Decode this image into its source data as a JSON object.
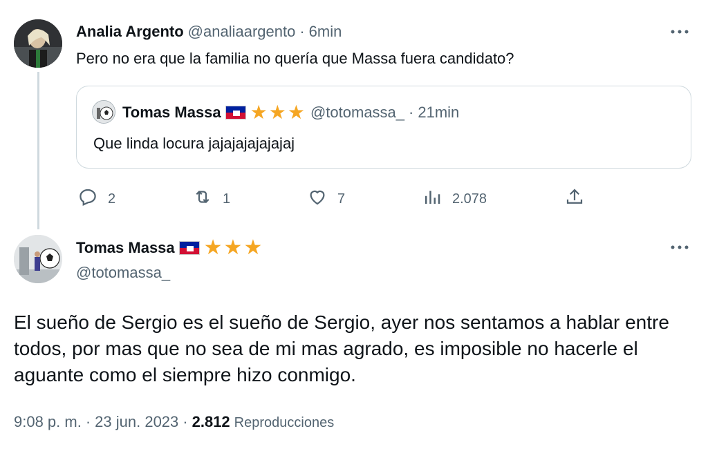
{
  "reply_tweet": {
    "author_name": "Analia Argento",
    "handle": "@analiaargento",
    "separator": "·",
    "time": "6min",
    "text": "Pero no era que la familia no quería que Massa fuera candidato?",
    "more_icon": "more-horizontal-icon",
    "quoted": {
      "author_name": "Tomas Massa",
      "stars": "★★★",
      "handle": "@totomassa_",
      "separator": "·",
      "time": "21min",
      "text": "Que linda locura jajajajajajajaj"
    },
    "actions": {
      "reply_count": "2",
      "retweet_count": "1",
      "like_count": "7",
      "views_count": "2.078"
    }
  },
  "main_tweet": {
    "author_name": "Tomas Massa",
    "stars": "★★★",
    "handle": "@totomassa_",
    "text": "El sueño de Sergio es el sueño de Sergio, ayer nos sentamos a hablar entre todos, por mas que no sea de mi mas agrado, es imposible no hacerle el aguante como el siempre hizo conmigo.",
    "time": "9:08 p. m.",
    "separator": "·",
    "date": "23 jun. 2023",
    "views_count": "2.812",
    "views_label": "Reproducciones"
  },
  "colors": {
    "text": "#0f1419",
    "muted": "#536471",
    "border": "#cfd9de",
    "star": "#f5a623"
  }
}
